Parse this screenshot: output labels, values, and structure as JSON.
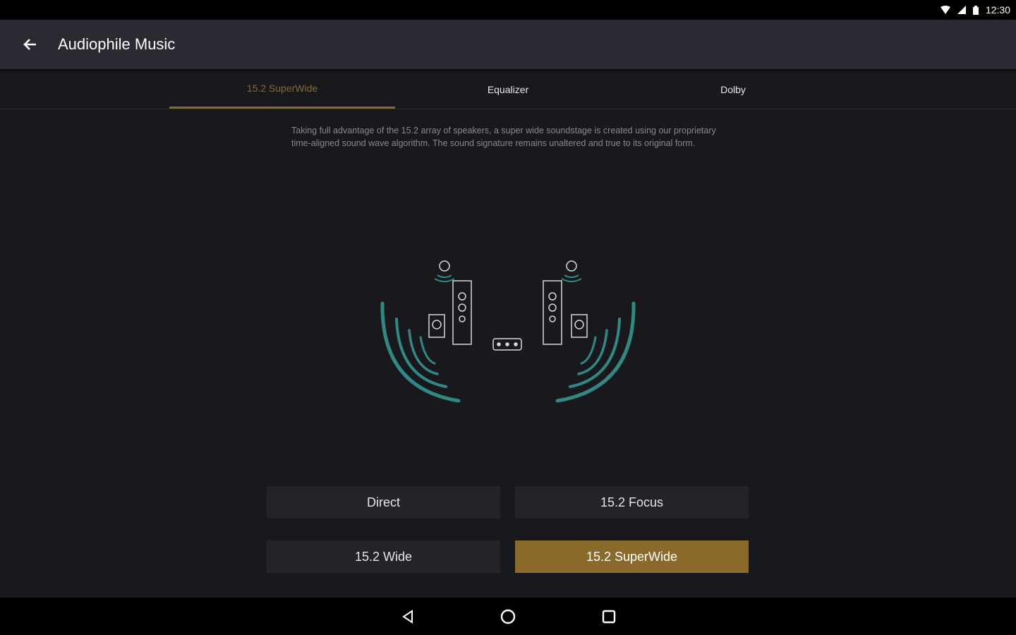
{
  "status_bar": {
    "time": "12:30"
  },
  "app_bar": {
    "title": "Audiophile Music"
  },
  "tabs": [
    {
      "label": "15.2 SuperWide",
      "active": true
    },
    {
      "label": "Equalizer",
      "active": false
    },
    {
      "label": "Dolby",
      "active": false
    }
  ],
  "description": "Taking full advantage of the 15.2 array of speakers, a super wide soundstage is created using our proprietary time-aligned sound wave algorithm. The sound signature remains unaltered and true to its original form.",
  "modes": [
    {
      "label": "Direct",
      "selected": false
    },
    {
      "label": "15.2 Focus",
      "selected": false
    },
    {
      "label": "15.2 Wide",
      "selected": false
    },
    {
      "label": "15.2 SuperWide",
      "selected": true
    }
  ],
  "colors": {
    "accent": "#8a6a2a",
    "wave": "#2f8a86",
    "background": "#18181d",
    "app_bar": "#2a2a33"
  }
}
